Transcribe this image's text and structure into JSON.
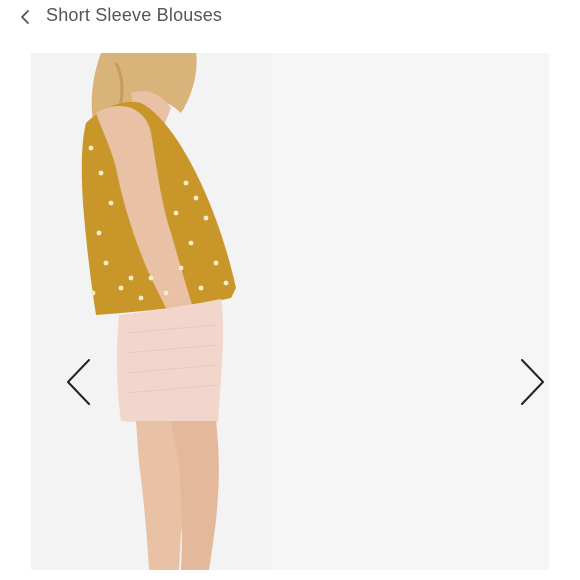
{
  "header": {
    "title": "Short Sleeve Blouses",
    "back_icon": "chevron-left-icon"
  },
  "gallery": {
    "prev_icon": "chevron-left-icon",
    "next_icon": "chevron-right-icon",
    "colors": {
      "background": "#f3f3f4",
      "top": "#c9962a",
      "skirt": "#f2d6cc",
      "skin": "#e9c2a6",
      "hair": "#d9b47a"
    }
  }
}
